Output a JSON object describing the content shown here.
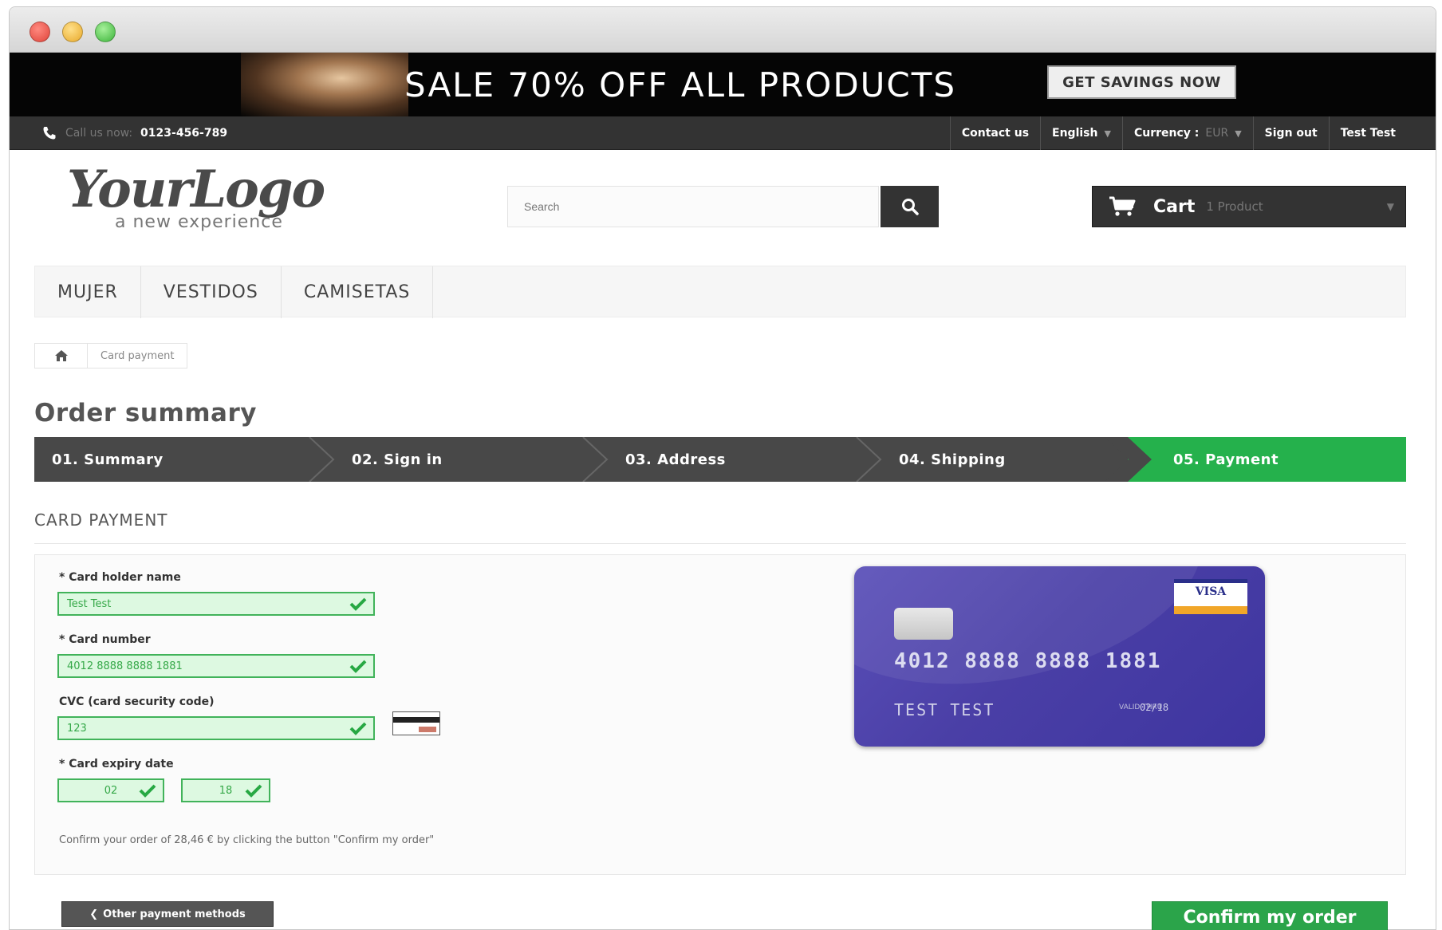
{
  "banner": {
    "headline": "SALE 70% OFF ALL PRODUCTS",
    "button_label": "GET SAVINGS NOW"
  },
  "topnav": {
    "call_label": "Call us now:",
    "phone": "0123-456-789",
    "contact": "Contact us",
    "language": "English",
    "currency_label": "Currency :",
    "currency_value": "EUR",
    "sign_out": "Sign out",
    "account": "Test Test"
  },
  "header": {
    "logo_main": "YourLogo",
    "logo_sub": "a new experience",
    "search_placeholder": "Search",
    "cart_label": "Cart",
    "cart_count": "1 Product"
  },
  "menu": {
    "items": [
      "MUJER",
      "VESTIDOS",
      "CAMISETAS"
    ]
  },
  "breadcrumb": {
    "current": "Card payment"
  },
  "page": {
    "title": "Order summary",
    "section": "CARD PAYMENT"
  },
  "steps": [
    "01. Summary",
    "02. Sign in",
    "03. Address",
    "04. Shipping",
    "05. Payment"
  ],
  "form": {
    "holder_label": "* Card holder name",
    "holder_value": "Test Test",
    "number_label": "* Card number",
    "number_value": "4012 8888 8888 1881",
    "cvc_label": "CVC (card security code)",
    "cvc_value": "123",
    "expiry_label": "* Card expiry date",
    "expiry_month": "02",
    "expiry_year": "18",
    "confirm_text": "Confirm your order of 28,46 € by clicking the button \"Confirm my order\""
  },
  "card_preview": {
    "brand": "VISA",
    "number": "4012 8888 8888 1881",
    "holder": "TEST TEST",
    "expiry_label": "VALID THRU",
    "expiry": "02/18"
  },
  "buttons": {
    "other_methods": "Other payment methods",
    "confirm": "Confirm my order"
  },
  "colors": {
    "accent_green": "#25b14c",
    "dark": "#333333",
    "card_purple": "#4a3fa6",
    "field_valid_bg": "#ddf9e1"
  }
}
